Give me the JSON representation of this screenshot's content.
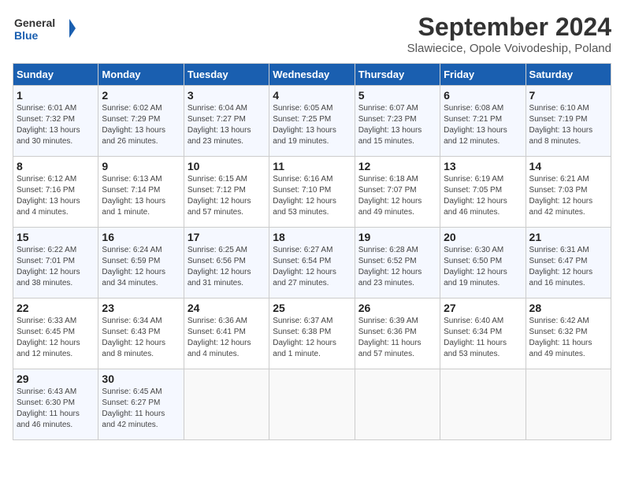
{
  "logo": {
    "text_general": "General",
    "text_blue": "Blue"
  },
  "header": {
    "title": "September 2024",
    "subtitle": "Slawiecice, Opole Voivodeship, Poland"
  },
  "weekdays": [
    "Sunday",
    "Monday",
    "Tuesday",
    "Wednesday",
    "Thursday",
    "Friday",
    "Saturday"
  ],
  "weeks": [
    [
      {
        "day": "1",
        "content": "Sunrise: 6:01 AM\nSunset: 7:32 PM\nDaylight: 13 hours\nand 30 minutes."
      },
      {
        "day": "2",
        "content": "Sunrise: 6:02 AM\nSunset: 7:29 PM\nDaylight: 13 hours\nand 26 minutes."
      },
      {
        "day": "3",
        "content": "Sunrise: 6:04 AM\nSunset: 7:27 PM\nDaylight: 13 hours\nand 23 minutes."
      },
      {
        "day": "4",
        "content": "Sunrise: 6:05 AM\nSunset: 7:25 PM\nDaylight: 13 hours\nand 19 minutes."
      },
      {
        "day": "5",
        "content": "Sunrise: 6:07 AM\nSunset: 7:23 PM\nDaylight: 13 hours\nand 15 minutes."
      },
      {
        "day": "6",
        "content": "Sunrise: 6:08 AM\nSunset: 7:21 PM\nDaylight: 13 hours\nand 12 minutes."
      },
      {
        "day": "7",
        "content": "Sunrise: 6:10 AM\nSunset: 7:19 PM\nDaylight: 13 hours\nand 8 minutes."
      }
    ],
    [
      {
        "day": "8",
        "content": "Sunrise: 6:12 AM\nSunset: 7:16 PM\nDaylight: 13 hours\nand 4 minutes."
      },
      {
        "day": "9",
        "content": "Sunrise: 6:13 AM\nSunset: 7:14 PM\nDaylight: 13 hours\nand 1 minute."
      },
      {
        "day": "10",
        "content": "Sunrise: 6:15 AM\nSunset: 7:12 PM\nDaylight: 12 hours\nand 57 minutes."
      },
      {
        "day": "11",
        "content": "Sunrise: 6:16 AM\nSunset: 7:10 PM\nDaylight: 12 hours\nand 53 minutes."
      },
      {
        "day": "12",
        "content": "Sunrise: 6:18 AM\nSunset: 7:07 PM\nDaylight: 12 hours\nand 49 minutes."
      },
      {
        "day": "13",
        "content": "Sunrise: 6:19 AM\nSunset: 7:05 PM\nDaylight: 12 hours\nand 46 minutes."
      },
      {
        "day": "14",
        "content": "Sunrise: 6:21 AM\nSunset: 7:03 PM\nDaylight: 12 hours\nand 42 minutes."
      }
    ],
    [
      {
        "day": "15",
        "content": "Sunrise: 6:22 AM\nSunset: 7:01 PM\nDaylight: 12 hours\nand 38 minutes."
      },
      {
        "day": "16",
        "content": "Sunrise: 6:24 AM\nSunset: 6:59 PM\nDaylight: 12 hours\nand 34 minutes."
      },
      {
        "day": "17",
        "content": "Sunrise: 6:25 AM\nSunset: 6:56 PM\nDaylight: 12 hours\nand 31 minutes."
      },
      {
        "day": "18",
        "content": "Sunrise: 6:27 AM\nSunset: 6:54 PM\nDaylight: 12 hours\nand 27 minutes."
      },
      {
        "day": "19",
        "content": "Sunrise: 6:28 AM\nSunset: 6:52 PM\nDaylight: 12 hours\nand 23 minutes."
      },
      {
        "day": "20",
        "content": "Sunrise: 6:30 AM\nSunset: 6:50 PM\nDaylight: 12 hours\nand 19 minutes."
      },
      {
        "day": "21",
        "content": "Sunrise: 6:31 AM\nSunset: 6:47 PM\nDaylight: 12 hours\nand 16 minutes."
      }
    ],
    [
      {
        "day": "22",
        "content": "Sunrise: 6:33 AM\nSunset: 6:45 PM\nDaylight: 12 hours\nand 12 minutes."
      },
      {
        "day": "23",
        "content": "Sunrise: 6:34 AM\nSunset: 6:43 PM\nDaylight: 12 hours\nand 8 minutes."
      },
      {
        "day": "24",
        "content": "Sunrise: 6:36 AM\nSunset: 6:41 PM\nDaylight: 12 hours\nand 4 minutes."
      },
      {
        "day": "25",
        "content": "Sunrise: 6:37 AM\nSunset: 6:38 PM\nDaylight: 12 hours\nand 1 minute."
      },
      {
        "day": "26",
        "content": "Sunrise: 6:39 AM\nSunset: 6:36 PM\nDaylight: 11 hours\nand 57 minutes."
      },
      {
        "day": "27",
        "content": "Sunrise: 6:40 AM\nSunset: 6:34 PM\nDaylight: 11 hours\nand 53 minutes."
      },
      {
        "day": "28",
        "content": "Sunrise: 6:42 AM\nSunset: 6:32 PM\nDaylight: 11 hours\nand 49 minutes."
      }
    ],
    [
      {
        "day": "29",
        "content": "Sunrise: 6:43 AM\nSunset: 6:30 PM\nDaylight: 11 hours\nand 46 minutes."
      },
      {
        "day": "30",
        "content": "Sunrise: 6:45 AM\nSunset: 6:27 PM\nDaylight: 11 hours\nand 42 minutes."
      },
      {
        "day": "",
        "content": ""
      },
      {
        "day": "",
        "content": ""
      },
      {
        "day": "",
        "content": ""
      },
      {
        "day": "",
        "content": ""
      },
      {
        "day": "",
        "content": ""
      }
    ]
  ]
}
